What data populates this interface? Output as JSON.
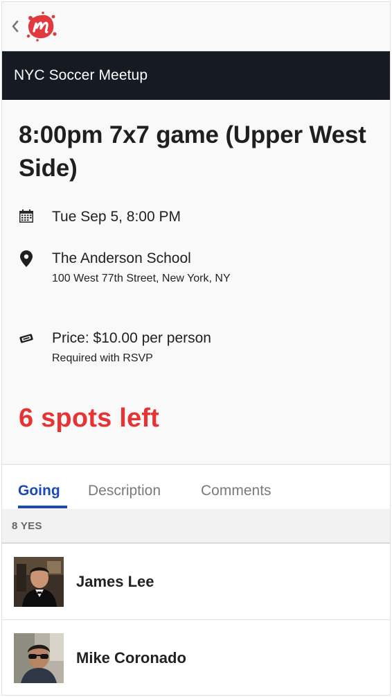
{
  "group": {
    "name": "NYC Soccer Meetup"
  },
  "event": {
    "title": "8:00pm 7x7 game (Upper West Side)",
    "datetime": "Tue Sep 5, 8:00 PM",
    "venue": {
      "name": "The Anderson School",
      "address": "100 West 77th Street, New York, NY"
    },
    "price": {
      "label": "Price: $10.00 per person",
      "note": "Required with RSVP"
    },
    "spots_left": "6 spots left"
  },
  "tabs": [
    {
      "label": "Going",
      "active": true
    },
    {
      "label": "Description",
      "active": false
    },
    {
      "label": "Comments",
      "active": false
    }
  ],
  "rsvp_count": "8 YES",
  "members": [
    {
      "name": "James Lee"
    },
    {
      "name": "Mike Coronado"
    }
  ],
  "colors": {
    "brand": "#e0393e",
    "link": "#1b49b6",
    "header_bg": "#151a23",
    "alert": "#e63434"
  },
  "icons": [
    "back-chevron-icon",
    "meetup-logo",
    "calendar-icon",
    "map-pin-icon",
    "ticket-icon"
  ]
}
